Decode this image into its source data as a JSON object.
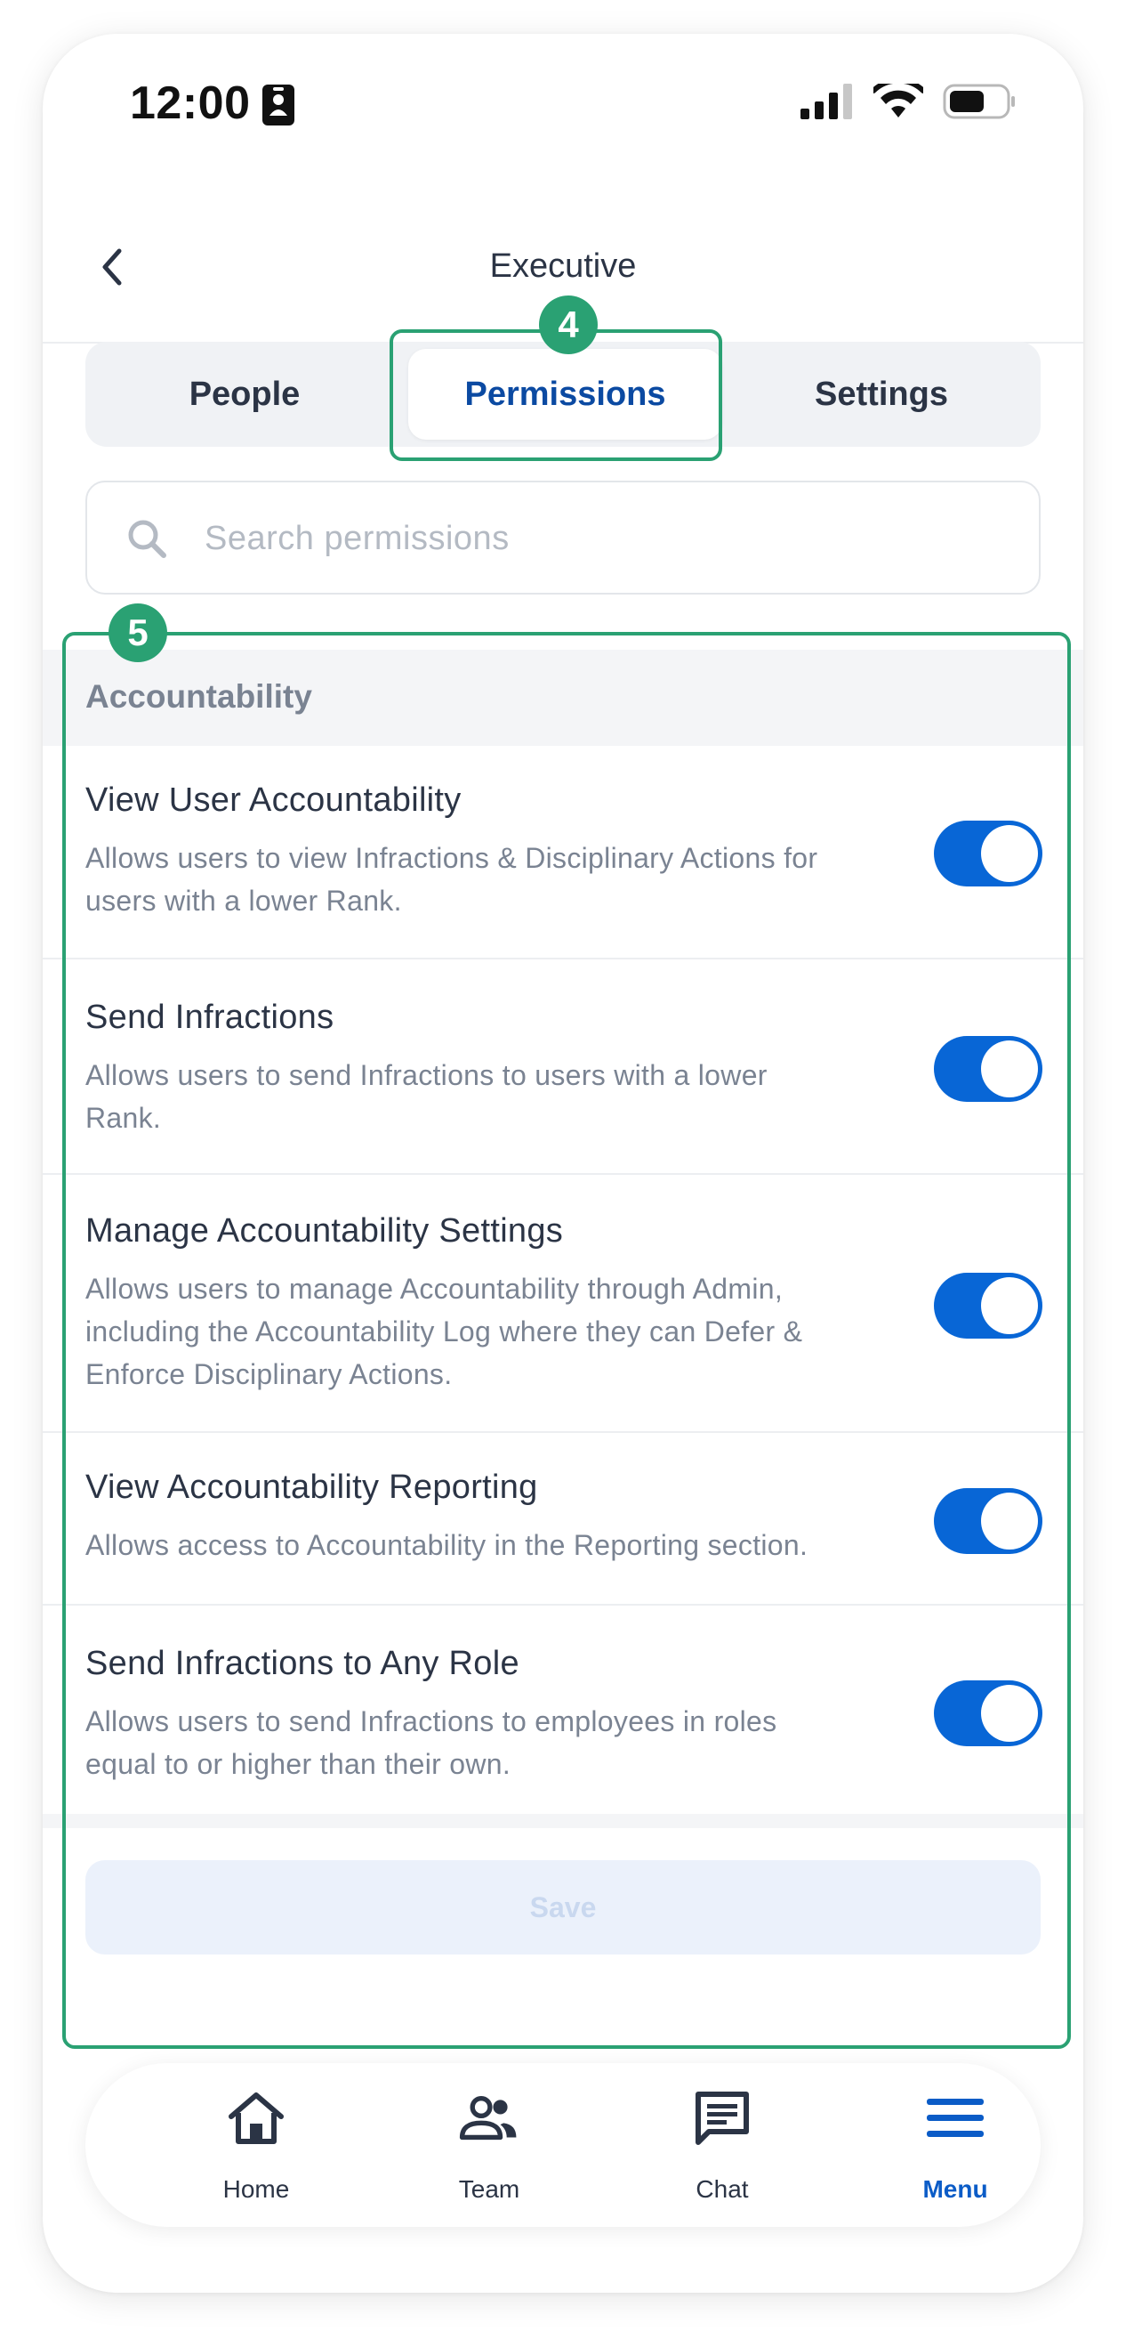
{
  "status_bar": {
    "time": "12:00"
  },
  "header": {
    "title": "Executive"
  },
  "tabs": [
    {
      "label": "People"
    },
    {
      "label": "Permissions"
    },
    {
      "label": "Settings"
    }
  ],
  "search": {
    "placeholder": "Search permissions"
  },
  "annotations": {
    "tabs_badge": "4",
    "list_badge": "5"
  },
  "section": {
    "title": "Accountability",
    "permissions": [
      {
        "title": "View User Accountability",
        "desc_lines": [
          "Allows users to view Infractions & Disciplinary Actions for",
          "users with a lower Rank."
        ],
        "enabled": true
      },
      {
        "title": "Send Infractions",
        "desc_lines": [
          "Allows users to send Infractions to users with a lower",
          "Rank."
        ],
        "enabled": true
      },
      {
        "title": "Manage Accountability Settings",
        "desc_lines": [
          "Allows users to manage Accountability through Admin,",
          "including the Accountability Log where they can Defer &",
          "Enforce Disciplinary Actions."
        ],
        "enabled": true
      },
      {
        "title": "View Accountability Reporting",
        "desc_lines": [
          "Allows access to Accountability in the Reporting section."
        ],
        "enabled": true
      },
      {
        "title": "Send Infractions to Any Role",
        "desc_lines": [
          "Allows users to send Infractions to employees in roles",
          "equal to or higher than their own."
        ],
        "enabled": true
      }
    ]
  },
  "save_label": "Save",
  "bottom_nav": [
    {
      "label": "Home",
      "icon": "home-icon"
    },
    {
      "label": "Team",
      "icon": "team-icon"
    },
    {
      "label": "Chat",
      "icon": "chat-icon"
    },
    {
      "label": "Menu",
      "icon": "menu-icon",
      "active": true
    }
  ],
  "colors": {
    "accent": "#0866d6",
    "annotation": "#2aa173",
    "text": "#2b3445",
    "muted": "#7a8392"
  }
}
